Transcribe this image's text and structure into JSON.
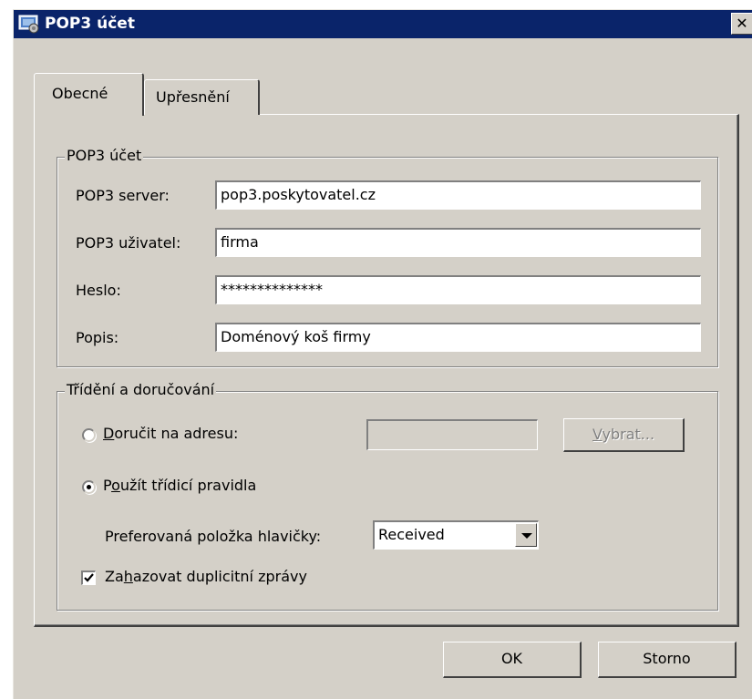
{
  "window": {
    "title": "POP3 účet",
    "close_glyph": "✕",
    "icon": "pop3-account-icon"
  },
  "tabs": [
    {
      "label": "Obecné",
      "active": true
    },
    {
      "label": "Upřesnění",
      "active": false
    }
  ],
  "account_group": {
    "legend": "POP3 účet",
    "server_label": "POP3 server:",
    "server_value": "pop3.poskytovatel.cz",
    "user_label": "POP3 uživatel:",
    "user_value": "firma",
    "password_label": "Heslo:",
    "password_value": "**************",
    "description_label": "Popis:",
    "description_value": "Doménový koš firmy"
  },
  "sorting_group": {
    "legend": "Třídění a doručování",
    "deliver_radio": {
      "pre": "",
      "accel": "D",
      "post": "oručit na adresu:",
      "selected": false
    },
    "deliver_address_value": "",
    "select_button": {
      "pre": "",
      "accel": "V",
      "post": "ybrat...",
      "enabled": false
    },
    "rules_radio": {
      "pre": "P",
      "accel": "o",
      "post": "užít třídicí pravidla",
      "selected": true
    },
    "header_label": "Preferovaná položka hlavičky:",
    "header_value": "Received",
    "discard_checkbox": {
      "pre": "Za",
      "accel": "h",
      "post": "azovat duplicitní zprávy",
      "checked": true
    }
  },
  "buttons": {
    "ok": "OK",
    "cancel": "Storno"
  }
}
